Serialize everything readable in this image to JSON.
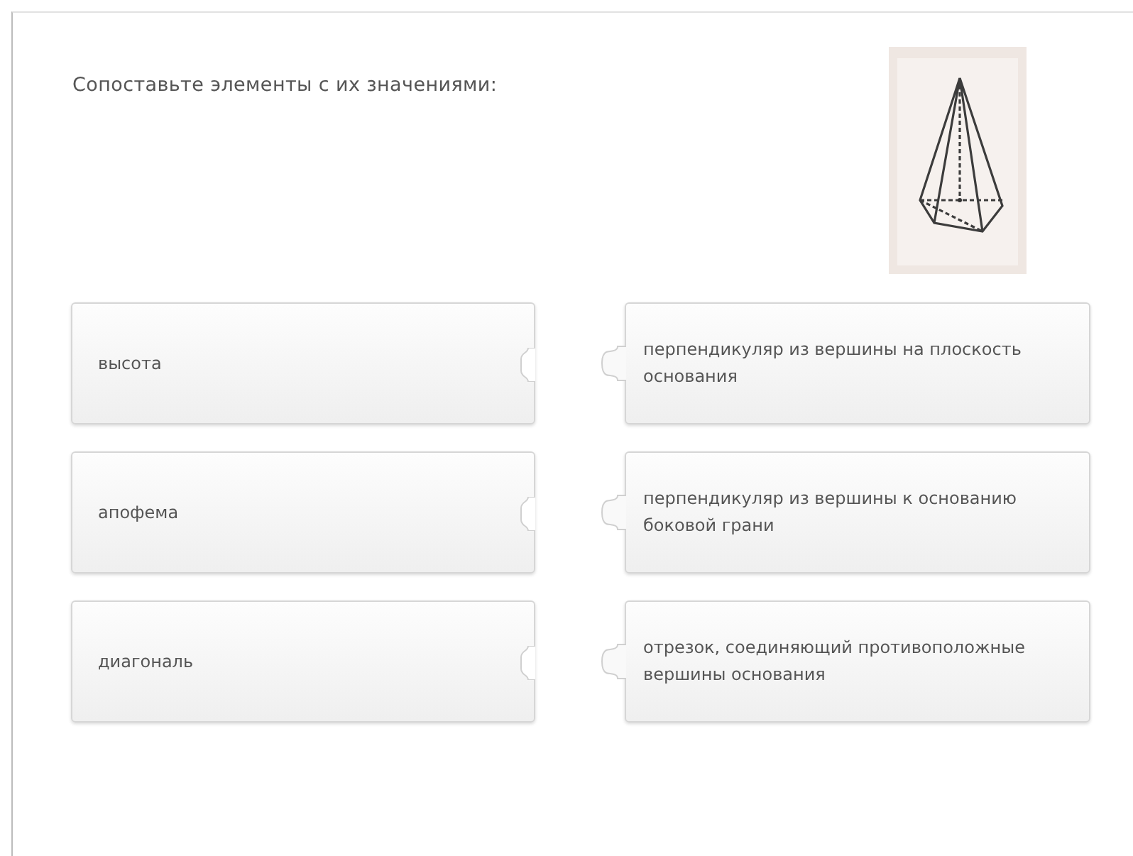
{
  "title": "Сопоставьте элементы с их значениями:",
  "pairs": [
    {
      "term": "высота",
      "definition": "перпендикуляр из вершины на плоскость основания"
    },
    {
      "term": "апофема",
      "definition": "перпендикуляр из вершины к основанию боковой грани"
    },
    {
      "term": "диагональ",
      "definition": "отрезок, соединяющий противоположные вершины основания"
    }
  ]
}
